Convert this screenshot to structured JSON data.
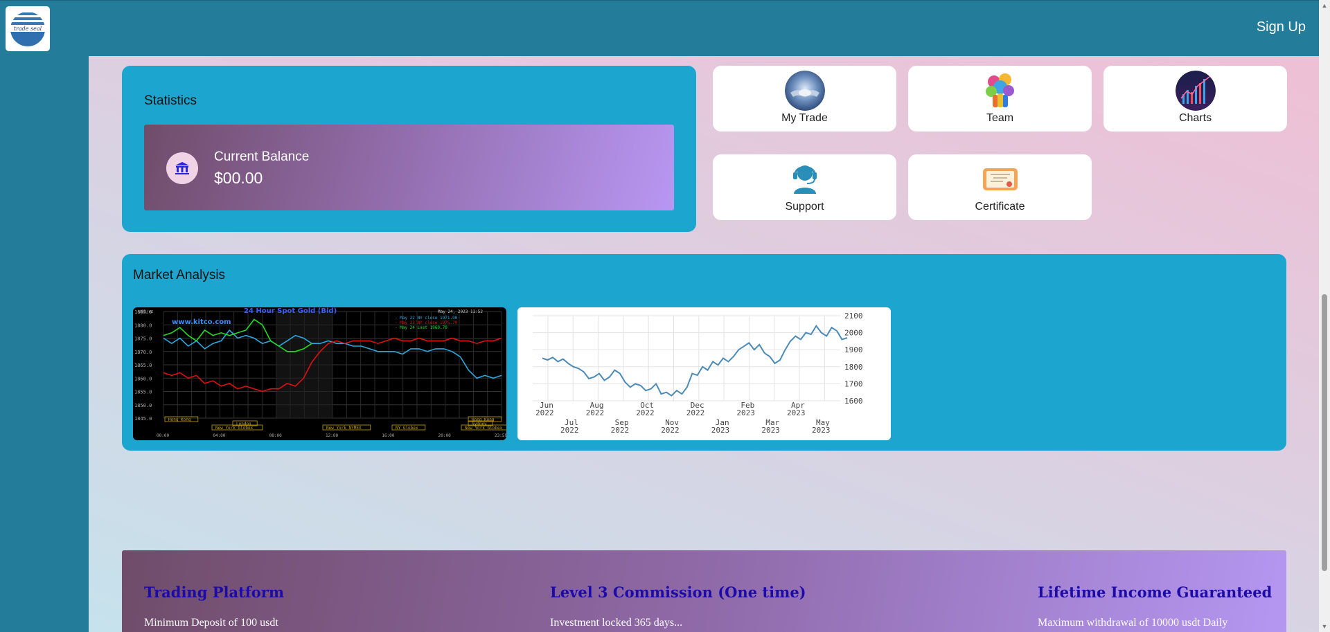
{
  "header": {
    "logo_text": "trade seal",
    "signup_label": "Sign Up"
  },
  "statistics": {
    "title": "Statistics",
    "balance_label": "Current Balance",
    "balance_value": "$00.00"
  },
  "tiles": [
    {
      "label": "My Trade",
      "icon": "handshake-globe-icon"
    },
    {
      "label": "Team",
      "icon": "team-icon"
    },
    {
      "label": "Charts",
      "icon": "charts-icon"
    },
    {
      "label": "Support",
      "icon": "support-headset-icon"
    },
    {
      "label": "Certificate",
      "icon": "certificate-icon"
    }
  ],
  "market": {
    "title": "Market Analysis"
  },
  "chart_data": [
    {
      "type": "line",
      "title": "24 Hour Spot Gold (Bid)",
      "source": "www.kitco.com",
      "date": "May 24, 2023 11:52",
      "ylabel": "USD/oz",
      "y_ticks": [
        "1885.0",
        "1880.0",
        "1875.0",
        "1870.0",
        "1865.0",
        "1860.0",
        "1855.0",
        "1850.0",
        "1845.0"
      ],
      "x_ticks": [
        "00:00",
        "04:00",
        "08:00",
        "12:00",
        "16:00",
        "20:00",
        "23:59"
      ],
      "sessions": [
        "Hong Kong",
        "London",
        "New York Globex",
        "New York NYMEX",
        "NY Globex",
        "Hong Kong",
        "Sydney",
        "New York Globex"
      ],
      "legend": [
        {
          "name": "May 22 NY close 1971.90",
          "color": "#29a8e0"
        },
        {
          "name": "May 23 NY close 1975.70",
          "color": "#e01010"
        },
        {
          "name": "May 24 Last 1969.70",
          "color": "#22dd22"
        }
      ],
      "series": [
        {
          "name": "May 22",
          "color": "#29a8e0",
          "values": [
            1875,
            1873,
            1875,
            1872,
            1874,
            1871,
            1873,
            1874,
            1878,
            1875,
            1876,
            1875,
            1873,
            1874,
            1872,
            1874,
            1876,
            1875,
            1873,
            1873,
            1874,
            1873,
            1873,
            1872,
            1872,
            1871,
            1870,
            1870,
            1870,
            1869,
            1871,
            1871,
            1870,
            1871,
            1871,
            1870,
            1868,
            1863,
            1860,
            1861,
            1860,
            1861
          ]
        },
        {
          "name": "May 23",
          "color": "#e01010",
          "values": [
            1862,
            1861,
            1862,
            1860,
            1861,
            1858,
            1859,
            1857,
            1858,
            1856,
            1857,
            1856,
            1855,
            1856,
            1856,
            1858,
            1857,
            1860,
            1866,
            1870,
            1873,
            1874,
            1873,
            1874,
            1874,
            1874,
            1873,
            1874,
            1875,
            1874,
            1874,
            1875,
            1874,
            1874,
            1874,
            1875,
            1874,
            1874,
            1873,
            1874,
            1874,
            1875
          ]
        },
        {
          "name": "May 24",
          "color": "#22dd22",
          "values": [
            1876,
            1877,
            1879,
            1876,
            1874,
            1878,
            1876,
            1877,
            1876,
            1877,
            1878,
            1882,
            1880,
            1874,
            1872,
            1870,
            1870,
            1871,
            1873
          ]
        }
      ]
    },
    {
      "type": "line",
      "y_ticks": [
        2100,
        2000,
        1900,
        1800,
        1700,
        1600
      ],
      "ylim": [
        1600,
        2100
      ],
      "x_ticks_top": [
        "Jun\n2022",
        "Aug\n2022",
        "Oct\n2022",
        "Dec\n2022",
        "Feb\n2023",
        "Apr\n2023"
      ],
      "x_ticks_bottom": [
        "Jul\n2022",
        "Sep\n2022",
        "Nov\n2022",
        "Jan\n2023",
        "Mar\n2023",
        "May\n2023"
      ],
      "series": [
        {
          "name": "",
          "color": "#4b8ab7",
          "values": [
            1850,
            1840,
            1855,
            1830,
            1845,
            1820,
            1800,
            1790,
            1770,
            1730,
            1740,
            1760,
            1720,
            1740,
            1780,
            1760,
            1710,
            1680,
            1700,
            1690,
            1660,
            1670,
            1700,
            1640,
            1650,
            1630,
            1660,
            1640,
            1680,
            1760,
            1750,
            1800,
            1780,
            1830,
            1810,
            1850,
            1830,
            1860,
            1900,
            1920,
            1940,
            1900,
            1930,
            1880,
            1860,
            1820,
            1840,
            1900,
            1950,
            1980,
            1960,
            2000,
            1990,
            2040,
            2000,
            1980,
            2030,
            2010,
            1960,
            1970
          ]
        }
      ]
    }
  ],
  "features": [
    {
      "title": "Trading Platform",
      "desc": "Minimum Deposit of 100 usdt"
    },
    {
      "title": "Level 3 Commission (One time)",
      "desc": "Investment locked 365 days..."
    },
    {
      "title": "Lifetime Income Guaranteed",
      "desc": "Maximum withdrawal of 10000 usdt Daily"
    }
  ]
}
